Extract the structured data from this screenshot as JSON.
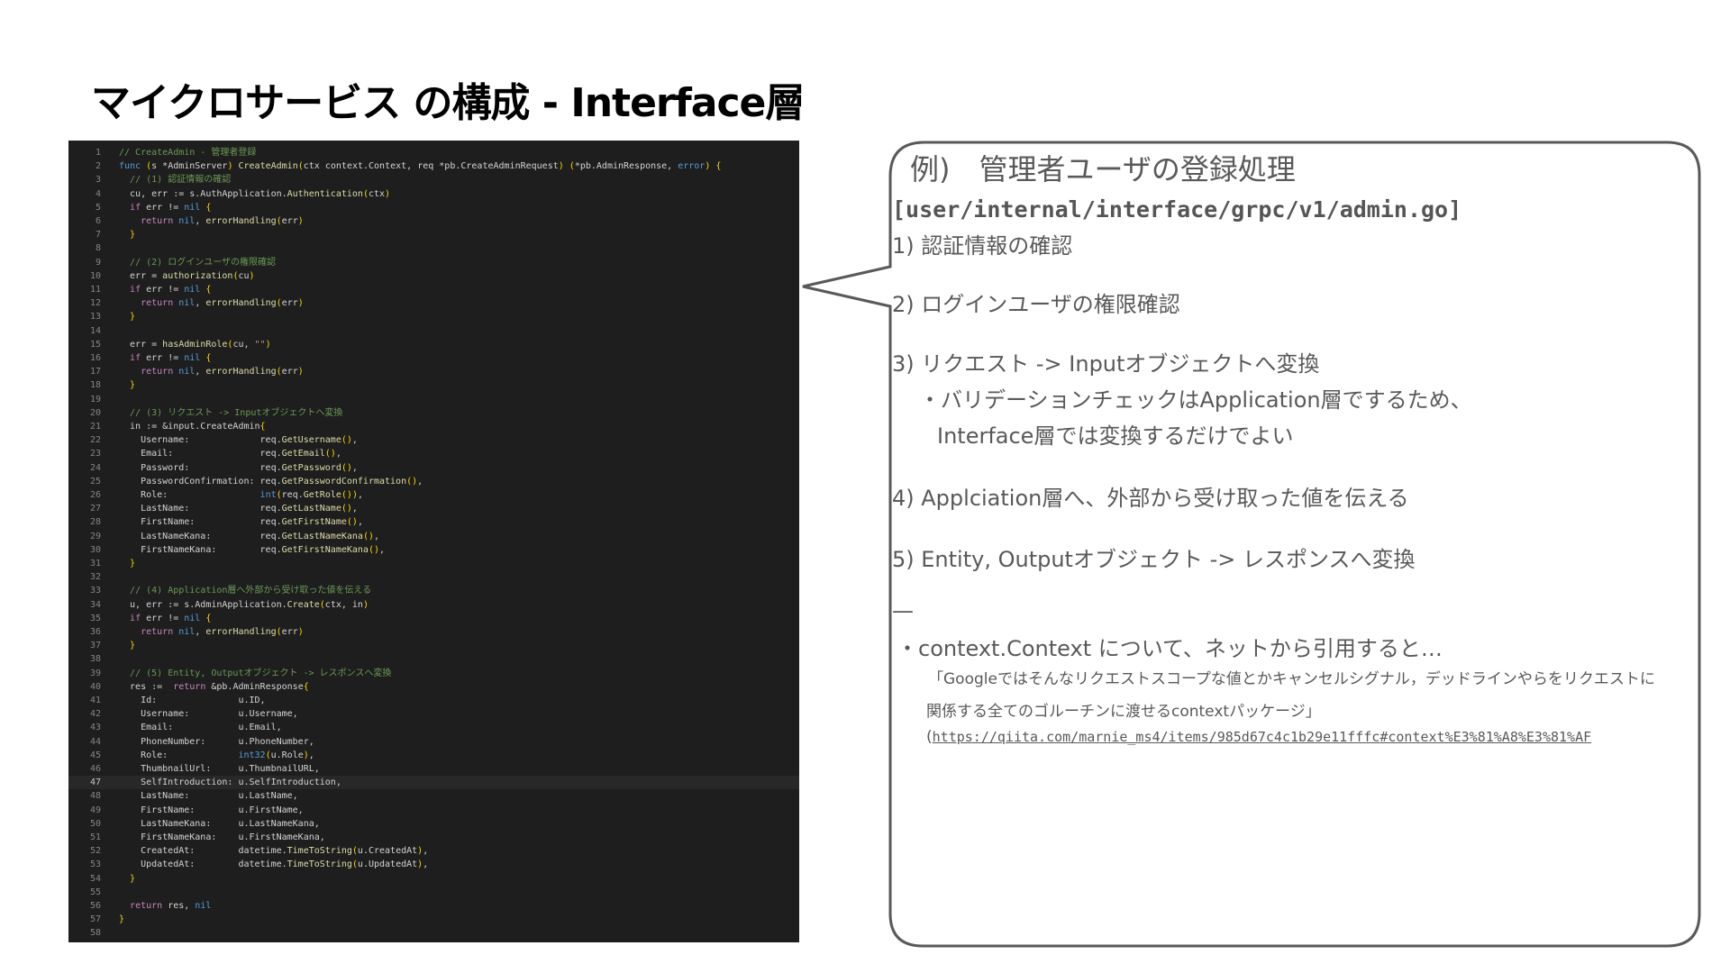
{
  "slide": {
    "title": "マイクロサービス の構成 - Interface層"
  },
  "code": {
    "lines": [
      {
        "n": "1",
        "t": "// CreateAdmin - 管理者登録"
      },
      {
        "n": "2",
        "t": "func (s *AdminServer) CreateAdmin(ctx context.Context, req *pb.CreateAdminRequest) (*pb.AdminResponse, error) {"
      },
      {
        "n": "3",
        "t": "  // (1) 認証情報の確認"
      },
      {
        "n": "4",
        "t": "  cu, err := s.AuthApplication.Authentication(ctx)"
      },
      {
        "n": "5",
        "t": "  if err != nil {"
      },
      {
        "n": "6",
        "t": "    return nil, errorHandling(err)"
      },
      {
        "n": "7",
        "t": "  }"
      },
      {
        "n": "8",
        "t": ""
      },
      {
        "n": "9",
        "t": "  // (2) ログインユーザの権限確認"
      },
      {
        "n": "10",
        "t": "  err = authorization(cu)"
      },
      {
        "n": "11",
        "t": "  if err != nil {"
      },
      {
        "n": "12",
        "t": "    return nil, errorHandling(err)"
      },
      {
        "n": "13",
        "t": "  }"
      },
      {
        "n": "14",
        "t": ""
      },
      {
        "n": "15",
        "t": "  err = hasAdminRole(cu, \"\")"
      },
      {
        "n": "16",
        "t": "  if err != nil {"
      },
      {
        "n": "17",
        "t": "    return nil, errorHandling(err)"
      },
      {
        "n": "18",
        "t": "  }"
      },
      {
        "n": "19",
        "t": ""
      },
      {
        "n": "20",
        "t": "  // (3) リクエスト -> Inputオブジェクトへ変換"
      },
      {
        "n": "21",
        "t": "  in := &input.CreateAdmin{"
      },
      {
        "n": "22",
        "t": "    Username:             req.GetUsername(),"
      },
      {
        "n": "23",
        "t": "    Email:                req.GetEmail(),"
      },
      {
        "n": "24",
        "t": "    Password:             req.GetPassword(),"
      },
      {
        "n": "25",
        "t": "    PasswordConfirmation: req.GetPasswordConfirmation(),"
      },
      {
        "n": "26",
        "t": "    Role:                 int(req.GetRole()),"
      },
      {
        "n": "27",
        "t": "    LastName:             req.GetLastName(),"
      },
      {
        "n": "28",
        "t": "    FirstName:            req.GetFirstName(),"
      },
      {
        "n": "29",
        "t": "    LastNameKana:         req.GetLastNameKana(),"
      },
      {
        "n": "30",
        "t": "    FirstNameKana:        req.GetFirstNameKana(),"
      },
      {
        "n": "31",
        "t": "  }"
      },
      {
        "n": "32",
        "t": ""
      },
      {
        "n": "33",
        "t": "  // (4) Application層へ外部から受け取った値を伝える"
      },
      {
        "n": "34",
        "t": "  u, err := s.AdminApplication.Create(ctx, in)"
      },
      {
        "n": "35",
        "t": "  if err != nil {"
      },
      {
        "n": "36",
        "t": "    return nil, errorHandling(err)"
      },
      {
        "n": "37",
        "t": "  }"
      },
      {
        "n": "38",
        "t": ""
      },
      {
        "n": "39",
        "t": "  // (5) Entity, Outputオブジェクト -> レスポンスへ変換"
      },
      {
        "n": "40",
        "t": "  res :=  return &pb.AdminResponse{"
      },
      {
        "n": "41",
        "t": "    Id:               u.ID,"
      },
      {
        "n": "42",
        "t": "    Username:         u.Username,"
      },
      {
        "n": "43",
        "t": "    Email:            u.Email,"
      },
      {
        "n": "44",
        "t": "    PhoneNumber:      u.PhoneNumber,"
      },
      {
        "n": "45",
        "t": "    Role:             int32(u.Role),"
      },
      {
        "n": "46",
        "t": "    ThumbnailUrl:     u.ThumbnailURL,"
      },
      {
        "n": "47",
        "t": "    SelfIntroduction: u.SelfIntroduction,"
      },
      {
        "n": "48",
        "t": "    LastName:         u.LastName,"
      },
      {
        "n": "49",
        "t": "    FirstName:        u.FirstName,"
      },
      {
        "n": "50",
        "t": "    LastNameKana:     u.LastNameKana,"
      },
      {
        "n": "51",
        "t": "    FirstNameKana:    u.FirstNameKana,"
      },
      {
        "n": "52",
        "t": "    CreatedAt:        datetime.TimeToString(u.CreatedAt),"
      },
      {
        "n": "53",
        "t": "    UpdatedAt:        datetime.TimeToString(u.UpdatedAt),"
      },
      {
        "n": "54",
        "t": "  }"
      },
      {
        "n": "55",
        "t": ""
      },
      {
        "n": "56",
        "t": "  return res, nil"
      },
      {
        "n": "57",
        "t": "}"
      },
      {
        "n": "58",
        "t": ""
      }
    ],
    "active_line": "47"
  },
  "notes": {
    "heading": "例)　管理者ユーザの登録処理",
    "path": "[user/internal/interface/grpc/v1/admin.go]",
    "step1": "1) 認証情報の確認",
    "step2": "2) ログインユーザの権限確認",
    "step3": "3) リクエスト -> Inputオブジェクトへ変換",
    "step3_bullet_a": "・バリデーションチェックはApplication層でするため、",
    "step3_bullet_b": "Interface層では変換するだけでよい",
    "step4": "4) Applciation層へ、外部から受け取った値を伝える",
    "step5": "5) Entity, Outputオブジェクト -> レスポンスへ変換",
    "divider": "—",
    "context_bullet": "・context.Context について、ネットから引用すると…",
    "quote_line1": "「Googleではそんなリクエストスコープな値とかキャンセルシグナル，デッドラインやらをリクエストに",
    "quote_line2": "関係する全てのゴルーチンに渡せるcontextパッケージ」",
    "quote_link_prefix": "(",
    "quote_link": "https://qiita.com/marnie_ms4/items/985d67c4c1b29e11fffc#context%E3%81%A8%E3%81%AF"
  }
}
